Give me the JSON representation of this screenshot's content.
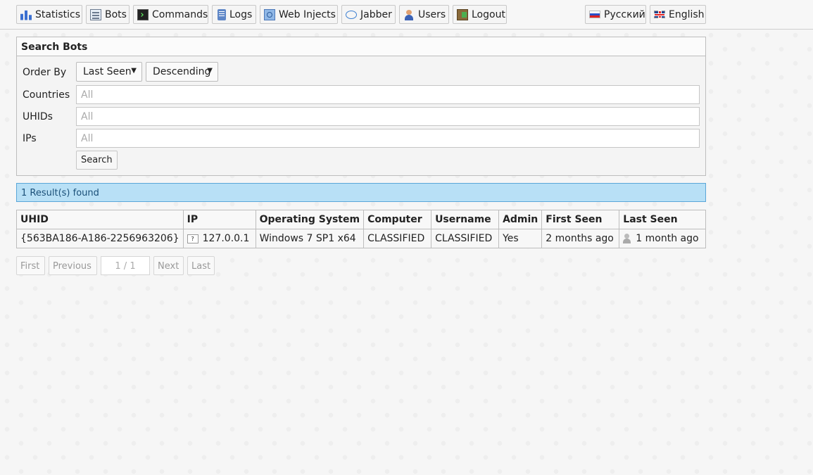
{
  "nav": {
    "statistics": "Statistics",
    "bots": "Bots",
    "commands": "Commands",
    "logs": "Logs",
    "web_injects": "Web Injects",
    "jabber": "Jabber",
    "users": "Users",
    "logout": "Logout"
  },
  "languages": {
    "russian": "Русский",
    "english": "English"
  },
  "search": {
    "title": "Search Bots",
    "order_by_label": "Order By",
    "order_by_value": "Last Seen",
    "direction_value": "Descending",
    "countries_label": "Countries",
    "countries_placeholder": "All",
    "uhids_label": "UHIDs",
    "uhids_placeholder": "All",
    "ips_label": "IPs",
    "ips_placeholder": "All",
    "search_button": "Search"
  },
  "results": {
    "summary": "1 Result(s) found",
    "columns": [
      "UHID",
      "IP",
      "Operating System",
      "Computer",
      "Username",
      "Admin",
      "First Seen",
      "Last Seen"
    ],
    "rows": [
      {
        "uhid": "{563BA186-A186-2256963206}",
        "ip": "127.0.0.1",
        "os": "Windows 7 SP1 x64",
        "computer": "CLASSIFIED",
        "username": "CLASSIFIED",
        "admin": "Yes",
        "first_seen": "2 months ago",
        "last_seen": "1 month ago"
      }
    ]
  },
  "pager": {
    "first": "First",
    "previous": "Previous",
    "page": "1 / 1",
    "next": "Next",
    "last": "Last"
  }
}
